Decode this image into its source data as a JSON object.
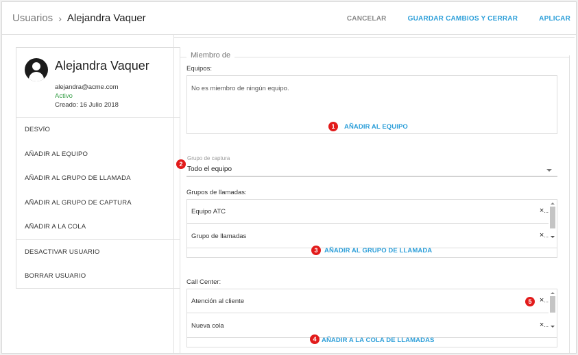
{
  "header": {
    "root": "Usuarios",
    "separator": "›",
    "current": "Alejandra Vaquer",
    "cancel": "CANCELAR",
    "save_close": "GUARDAR CAMBIOS Y CERRAR",
    "apply": "APLICAR"
  },
  "profile": {
    "name": "Alejandra Vaquer",
    "email": "alejandra@acme.com",
    "status": "Activo",
    "created": "Creado: 16 Julio 2018"
  },
  "menu": {
    "items": [
      "DESVÍO",
      "AÑADIR AL EQUIPO",
      "AÑADIR AL GRUPO DE LLAMADA",
      "AÑADIR AL GRUPO DE CAPTURA",
      "AÑADIR A LA COLA"
    ],
    "deactivate": "DESACTIVAR USUARIO",
    "delete": "BORRAR USUARIO"
  },
  "member": {
    "legend": "Miembro de",
    "teams_label": "Equipos:",
    "teams_empty": "No es miembro de ningún equipo.",
    "add_team": "AÑADIR AL EQUIPO",
    "pickup_label": "Grupo de captura",
    "pickup_value": "Todo el equipo",
    "call_groups_label": "Grupos de llamadas:",
    "call_groups": [
      "Equipo ATC",
      "Grupo de llamadas"
    ],
    "add_call_group": "AÑADIR AL GRUPO DE LLAMADA",
    "call_center_label": "Call Center:",
    "queues": [
      "Atención al cliente",
      "Nueva cola"
    ],
    "add_queue": "AÑADIR A LA COLA DE LLAMADAS",
    "remove": "×",
    "ellipsis": "..."
  },
  "badges": [
    "1",
    "2",
    "3",
    "4",
    "5"
  ],
  "colors": {
    "accent": "#2d9fd9",
    "active": "#3aa04a",
    "badge": "#e21b1b"
  }
}
